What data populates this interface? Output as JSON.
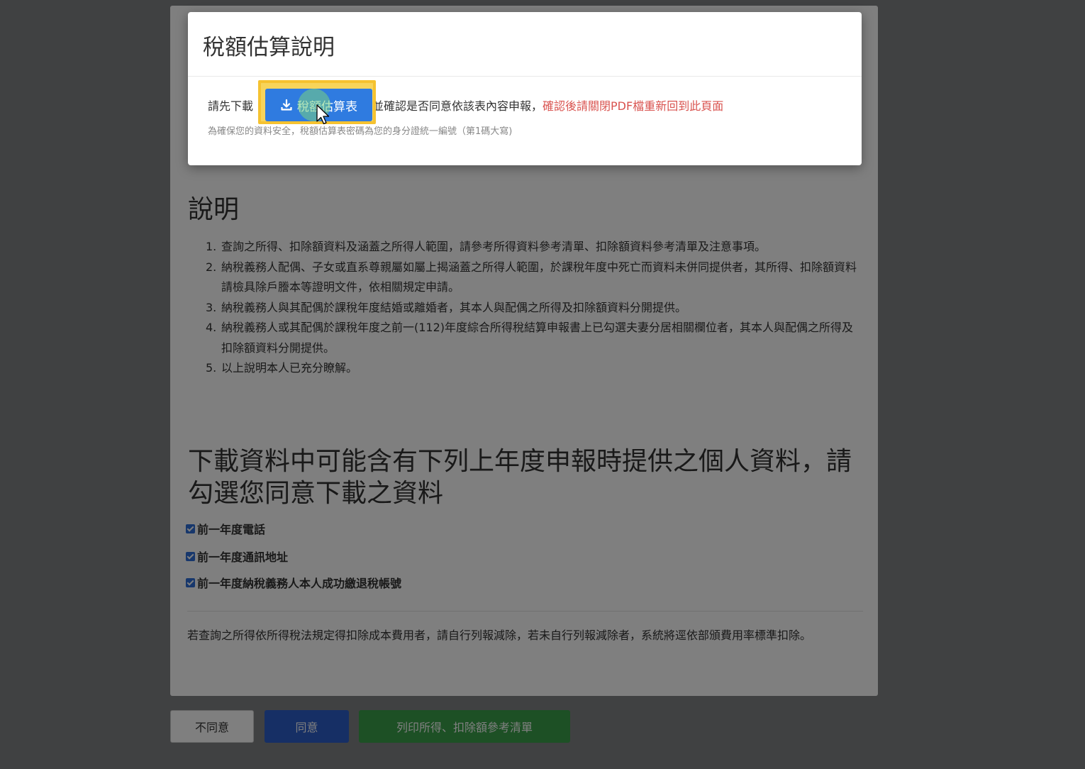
{
  "page": {
    "section_title": "說明",
    "notes": [
      {
        "num": "1.",
        "text": "查詢之所得、扣除額資料及涵蓋之所得人範圍，請參考所得資料參考清單、扣除額資料參考清單及注意事項。"
      },
      {
        "num": "2.",
        "text": "納稅義務人配偶、子女或直系尊親屬如屬上揭涵蓋之所得人範圍，於課稅年度中死亡而資料未併同提供者，其所得、扣除額資料請檢具除戶謄本等證明文件，依相關規定申請。"
      },
      {
        "num": "3.",
        "text": "納稅義務人與其配偶於課稅年度結婚或離婚者，其本人與配偶之所得及扣除額資料分開提供。"
      },
      {
        "num": "4.",
        "text": "納稅義務人或其配偶於課稅年度之前一(112)年度綜合所得稅結算申報書上已勾選夫妻分居相關欄位者，其本人與配偶之所得及扣除額資料分開提供。"
      },
      {
        "num": "5.",
        "text": "以上說明本人已充分瞭解。"
      }
    ],
    "consent_heading": "下載資料中可能含有下列上年度申報時提供之個人資料，請勾選您同意下載之資料",
    "checkboxes": [
      {
        "label": "前一年度電話",
        "checked": true
      },
      {
        "label": "前一年度通訊地址",
        "checked": true
      },
      {
        "label": "前一年度納稅義務人本人成功繳退稅帳號",
        "checked": true
      }
    ],
    "cost_note": "若查詢之所得依所得稅法規定得扣除成本費用者，請自行列報減除，若未自行列報減除者，系統將逕依部頒費用率標準扣除。",
    "buttons": {
      "disagree": "不同意",
      "agree": "同意",
      "print": "列印所得、扣除額參考清單"
    }
  },
  "modal": {
    "title": "稅額估算說明",
    "line1_prefix": "請先下載",
    "line1_mid": "並確認是否同意依該表內容申報，",
    "line1_warning": "確認後請關閉PDF檔重新回到此頁面",
    "line2": "為確保您的資料安全，稅額估算表密碼為您的身分證統一編號（第1碼大寫)",
    "download_button": "稅額估算表",
    "download_icon": "download-icon"
  },
  "colors": {
    "agree": "#2c5fcb",
    "print": "#3aa04a",
    "warning": "#d9534f",
    "download": "#2f7be0",
    "highlight": "#f5c230"
  }
}
